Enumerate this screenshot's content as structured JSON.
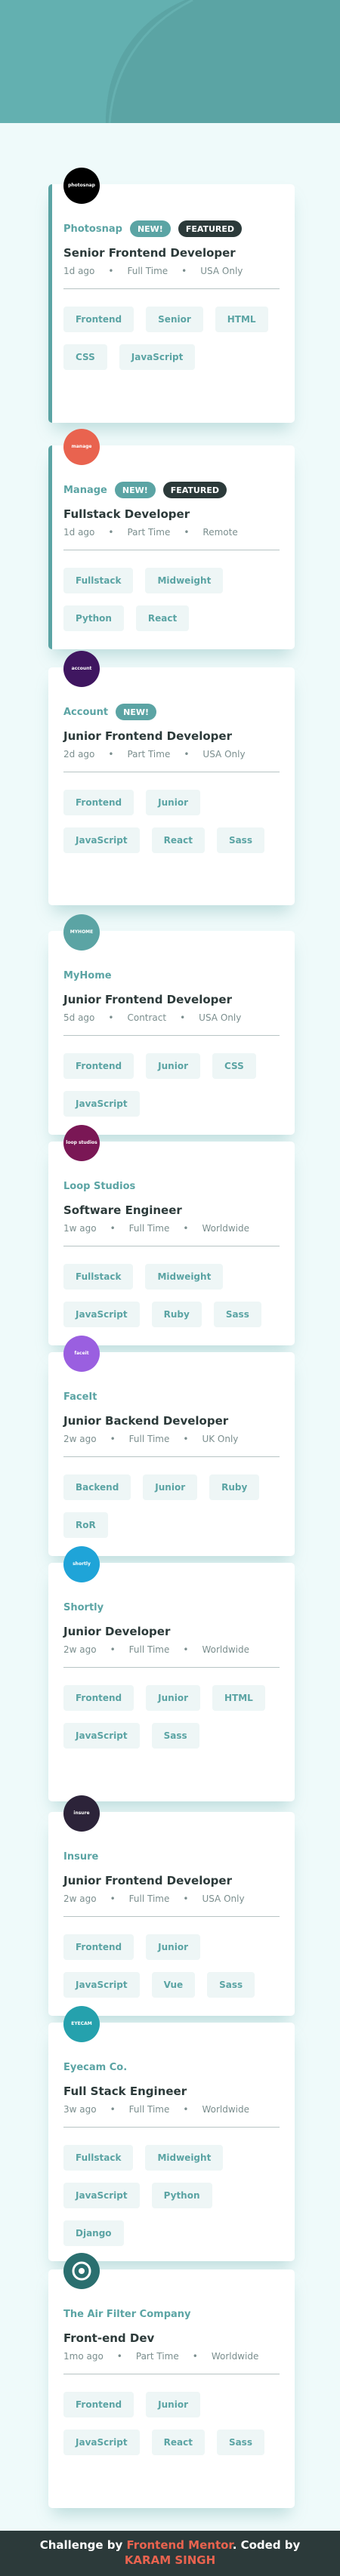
{
  "colors": {
    "primary": "#5ba4a4",
    "background": "#effafa",
    "dark": "#2c3a3a",
    "tag_bg": "#eef6f6",
    "footer_link": "#e9634f"
  },
  "jobs": [
    {
      "company": "Photosnap",
      "logo_text": "photosnap",
      "logo_color": "#000000",
      "new_label": "NEW!",
      "featured_label": "FEATURED",
      "position": "Senior Frontend Developer",
      "posted": "1d ago",
      "contract": "Full Time",
      "location": "USA Only",
      "tags": [
        "Frontend",
        "Senior",
        "HTML",
        "CSS",
        "JavaScript"
      ]
    },
    {
      "company": "Manage",
      "logo_text": "manage",
      "logo_color": "#e9634f",
      "new_label": "NEW!",
      "featured_label": "FEATURED",
      "position": "Fullstack Developer",
      "posted": "1d ago",
      "contract": "Part Time",
      "location": "Remote",
      "tags": [
        "Fullstack",
        "Midweight",
        "Python",
        "React"
      ]
    },
    {
      "company": "Account",
      "logo_text": "account",
      "logo_color": "#3f1660",
      "new_label": "NEW!",
      "position": "Junior Frontend Developer",
      "posted": "2d ago",
      "contract": "Part Time",
      "location": "USA Only",
      "tags": [
        "Frontend",
        "Junior",
        "JavaScript",
        "React",
        "Sass"
      ]
    },
    {
      "company": "MyHome",
      "logo_text": "MYHOME",
      "logo_color": "#5ba4a4",
      "position": "Junior Frontend Developer",
      "posted": "5d ago",
      "contract": "Contract",
      "location": "USA Only",
      "tags": [
        "Frontend",
        "Junior",
        "CSS",
        "JavaScript"
      ]
    },
    {
      "company": "Loop Studios",
      "logo_text": "loop studios",
      "logo_color": "#7a1755",
      "position": "Software Engineer",
      "posted": "1w ago",
      "contract": "Full Time",
      "location": "Worldwide",
      "tags": [
        "Fullstack",
        "Midweight",
        "JavaScript",
        "Ruby",
        "Sass"
      ]
    },
    {
      "company": "FaceIt",
      "logo_text": "faceit",
      "logo_color": "#9a5fe0",
      "position": "Junior Backend Developer",
      "posted": "2w ago",
      "contract": "Full Time",
      "location": "UK Only",
      "tags": [
        "Backend",
        "Junior",
        "Ruby",
        "RoR"
      ]
    },
    {
      "company": "Shortly",
      "logo_text": "shortly",
      "logo_color": "#1fa4d8",
      "position": "Junior Developer",
      "posted": "2w ago",
      "contract": "Full Time",
      "location": "Worldwide",
      "tags": [
        "Frontend",
        "Junior",
        "HTML",
        "JavaScript",
        "Sass"
      ]
    },
    {
      "company": "Insure",
      "logo_text": "insure",
      "logo_color": "#2c2339",
      "position": "Junior Frontend Developer",
      "posted": "2w ago",
      "contract": "Full Time",
      "location": "USA Only",
      "tags": [
        "Frontend",
        "Junior",
        "JavaScript",
        "Vue",
        "Sass"
      ]
    },
    {
      "company": "Eyecam Co.",
      "logo_text": "EYECAM",
      "logo_color": "#25a1ad",
      "position": "Full Stack Engineer",
      "posted": "3w ago",
      "contract": "Full Time",
      "location": "Worldwide",
      "tags": [
        "Fullstack",
        "Midweight",
        "JavaScript",
        "Python",
        "Django"
      ]
    },
    {
      "company": "The Air Filter Company",
      "logo_text": "",
      "logo_color": "#2a6f6f",
      "position": "Front-end Dev",
      "posted": "1mo ago",
      "contract": "Part Time",
      "location": "Worldwide",
      "tags": [
        "Frontend",
        "Junior",
        "JavaScript",
        "React",
        "Sass"
      ]
    }
  ],
  "footer": {
    "prefix": "Challenge by ",
    "mentor": "Frontend Mentor",
    "middle": ". Coded by ",
    "author": "KARAM SINGH"
  }
}
